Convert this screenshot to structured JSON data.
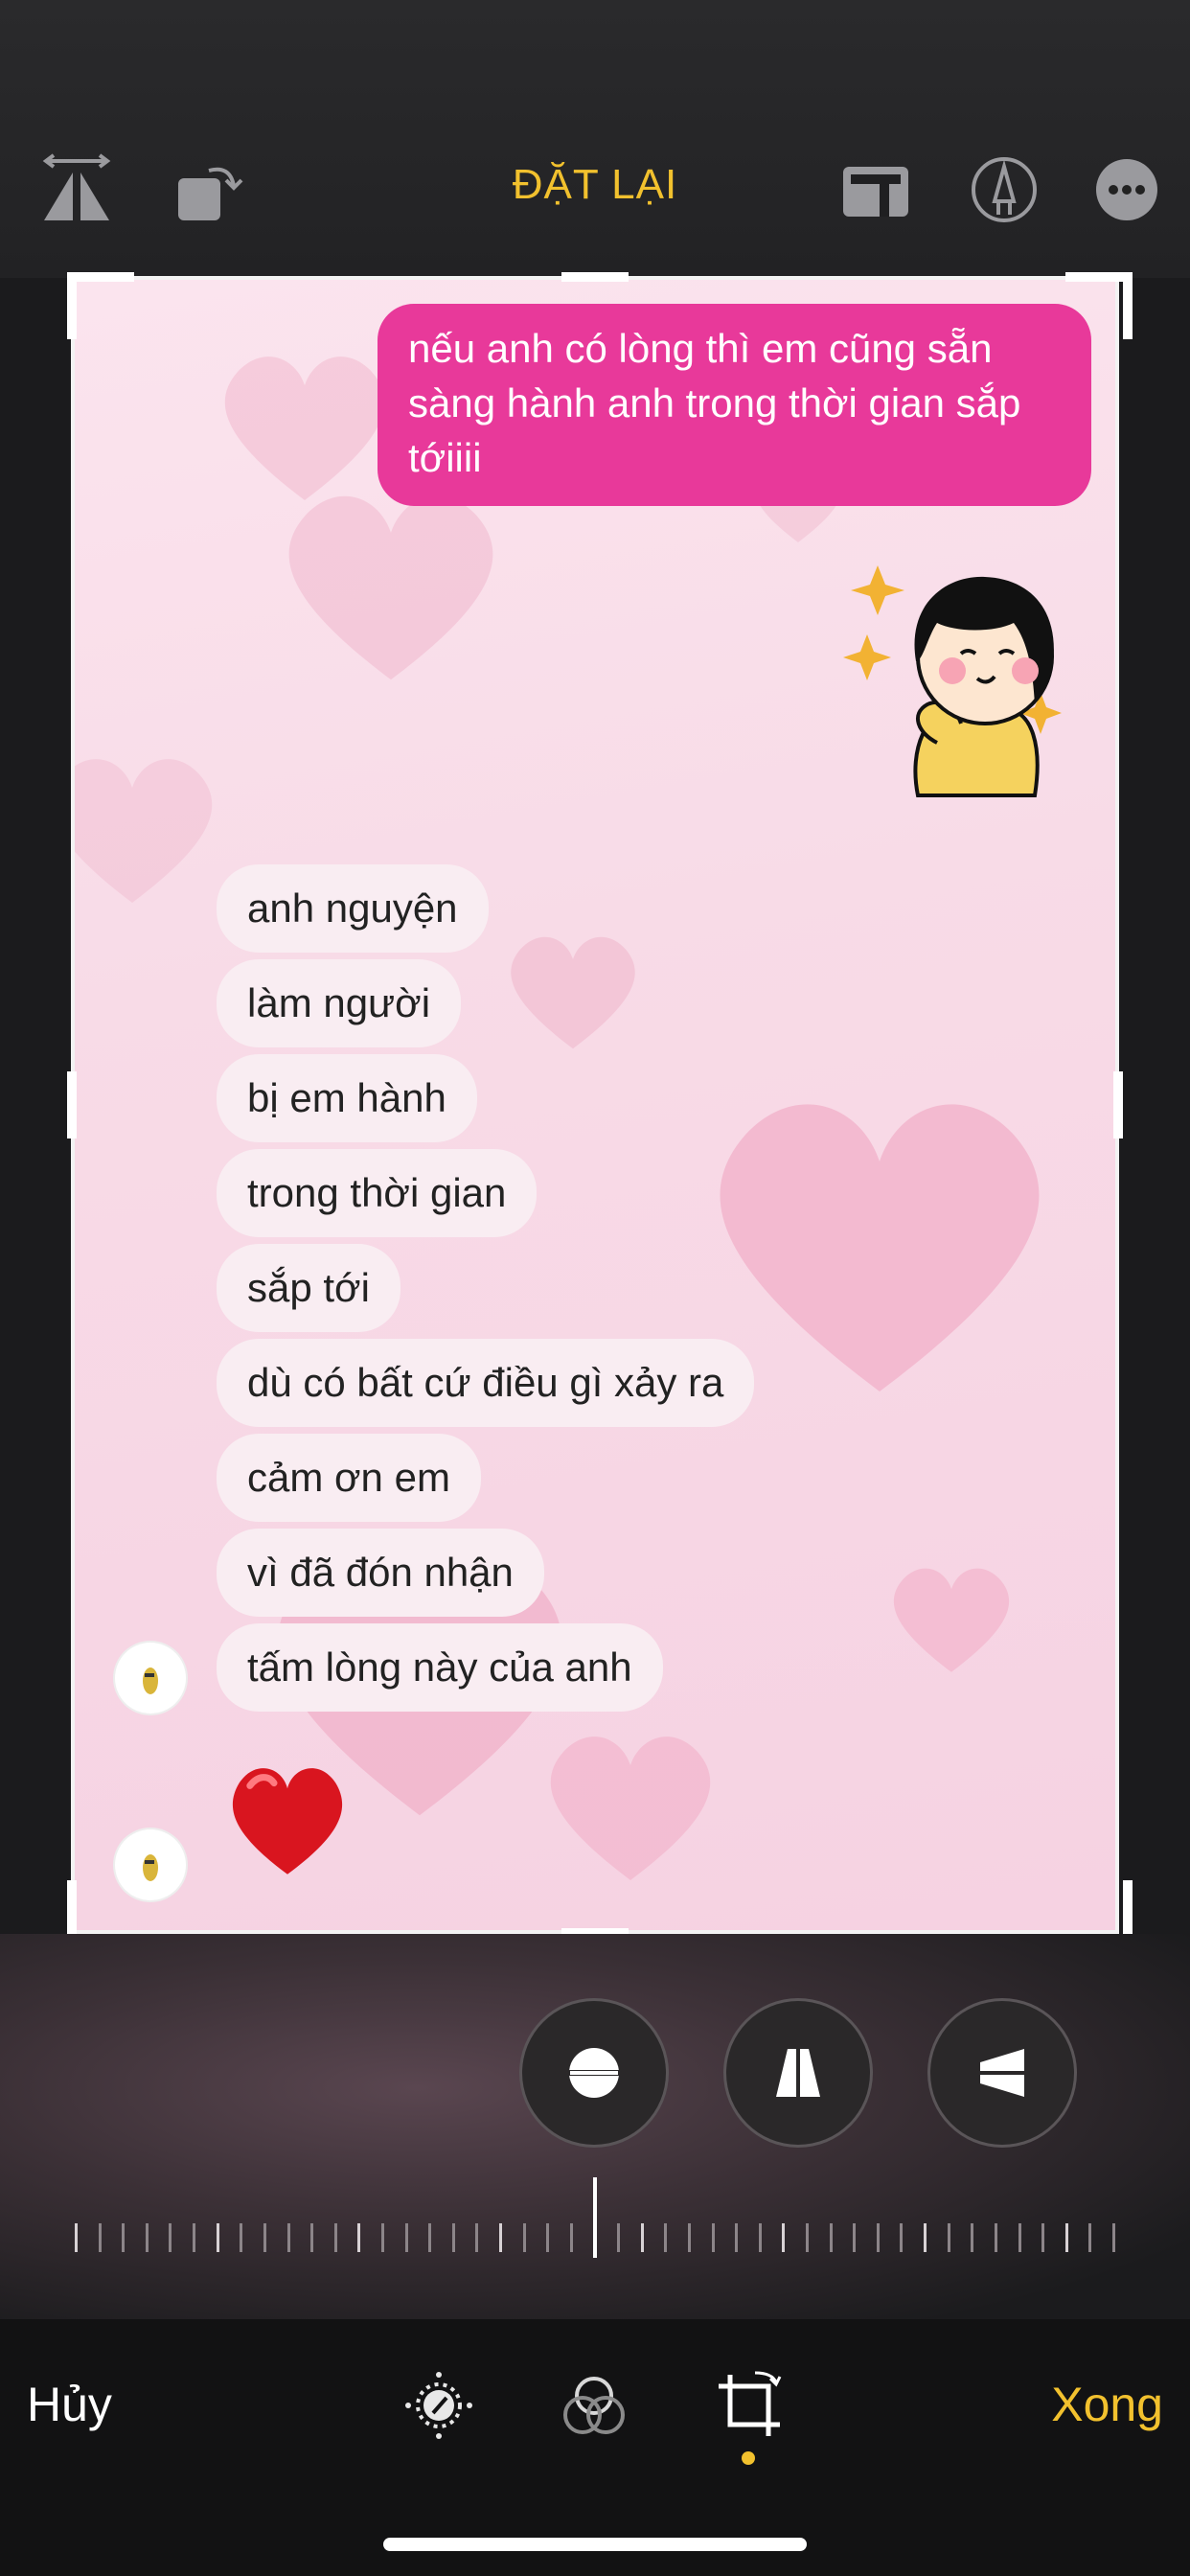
{
  "toolbar": {
    "title": "ĐẶT LẠI",
    "icons": [
      "flip-horizontal-icon",
      "rotate-icon",
      "aspect-ratio-icon",
      "markup-icon",
      "more-icon"
    ]
  },
  "photo": {
    "sent_message": "nếu anh có lòng thì  em cũng sẵn sàng hành anh trong thời gian sắp tớiiii",
    "received_messages": [
      "anh nguyện",
      "làm người",
      "bị em hành",
      "trong thời gian",
      "sắp tới",
      "dù có bất cứ điều gì xảy ra",
      "cảm ơn em",
      "vì đã đón nhận",
      "tấm lòng này của anh"
    ],
    "sticker": "girl-thinking-sticker",
    "emoji": "red-heart"
  },
  "adjust_buttons": [
    "straighten-icon",
    "vertical-perspective-icon",
    "horizontal-perspective-icon"
  ],
  "bottom": {
    "cancel_label": "Hủy",
    "done_label": "Xong",
    "tools": [
      "adjust-icon",
      "filters-icon",
      "crop-icon"
    ],
    "active_tool": "crop-icon"
  },
  "colors": {
    "accent": "#f2c12e",
    "sent_bubble": "#e8399a",
    "received_bubble": "#f9edf2"
  }
}
